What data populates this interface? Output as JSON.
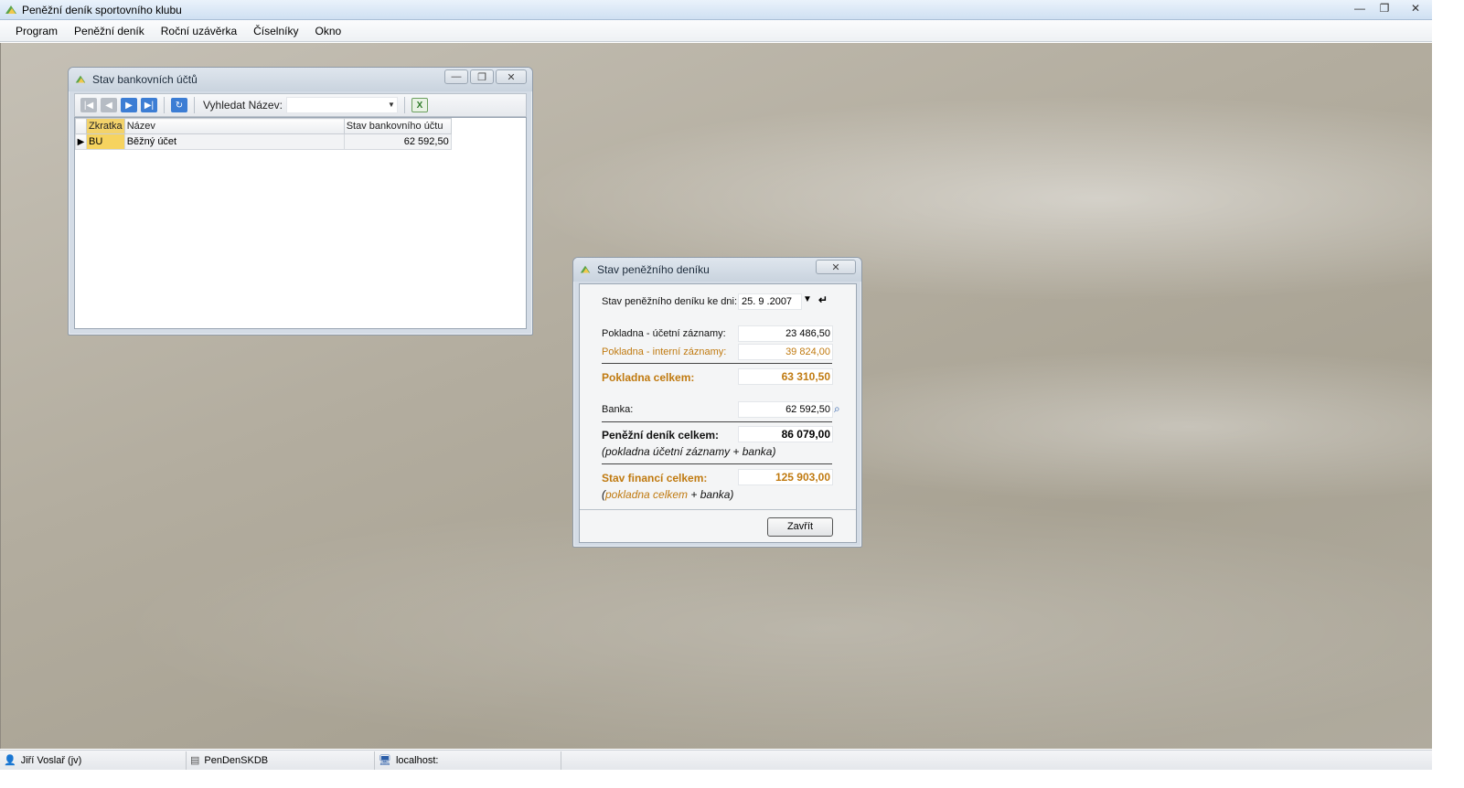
{
  "app": {
    "title": "Peněžní deník sportovního klubu",
    "controls": {
      "minimize": "—",
      "maximize": "❐",
      "close": "✕"
    }
  },
  "menu": [
    "Program",
    "Peněžní deník",
    "Roční uzávěrka",
    "Číselníky",
    "Okno"
  ],
  "bank_window": {
    "title": "Stav bankovních účtů",
    "search_label": "Vyhledat Název:",
    "search_value": "",
    "columns": [
      "Zkratka",
      "Název",
      "Stav bankovního účtu"
    ],
    "rows": [
      {
        "zkratka": "BU",
        "nazev": "Běžný účet",
        "stav": "62 592,50"
      }
    ]
  },
  "cash_dialog": {
    "title": "Stav peněžního deníku",
    "date_label": "Stav peněžního deníku ke dni:",
    "date_value": "25. 9 .2007",
    "pokladna_ucetni_label": "Pokladna - účetní záznamy:",
    "pokladna_ucetni_value": "23 486,50",
    "pokladna_interni_label": "Pokladna - interní záznamy:",
    "pokladna_interni_value": "39 824,00",
    "pokladna_celkem_label": "Pokladna celkem:",
    "pokladna_celkem_value": "63 310,50",
    "banka_label": "Banka:",
    "banka_value": "62 592,50",
    "denik_celkem_label": "Peněžní deník celkem:",
    "denik_celkem_value": "86 079,00",
    "denik_celkem_note": "(pokladna účetní záznamy + banka)",
    "financi_celkem_label": "Stav financí celkem:",
    "financi_celkem_value": "125 903,00",
    "financi_note_open": "(",
    "financi_note_orange": "pokladna celkem",
    "financi_note_rest": " + banka)",
    "close_button": "Zavřít"
  },
  "status": {
    "user": "Jiří Voslař  (jv)",
    "database": "PenDenSKDB",
    "server": "localhost:"
  },
  "colors": {
    "accent_orange": "#c07a10",
    "selection_yellow": "#f6d35f"
  }
}
